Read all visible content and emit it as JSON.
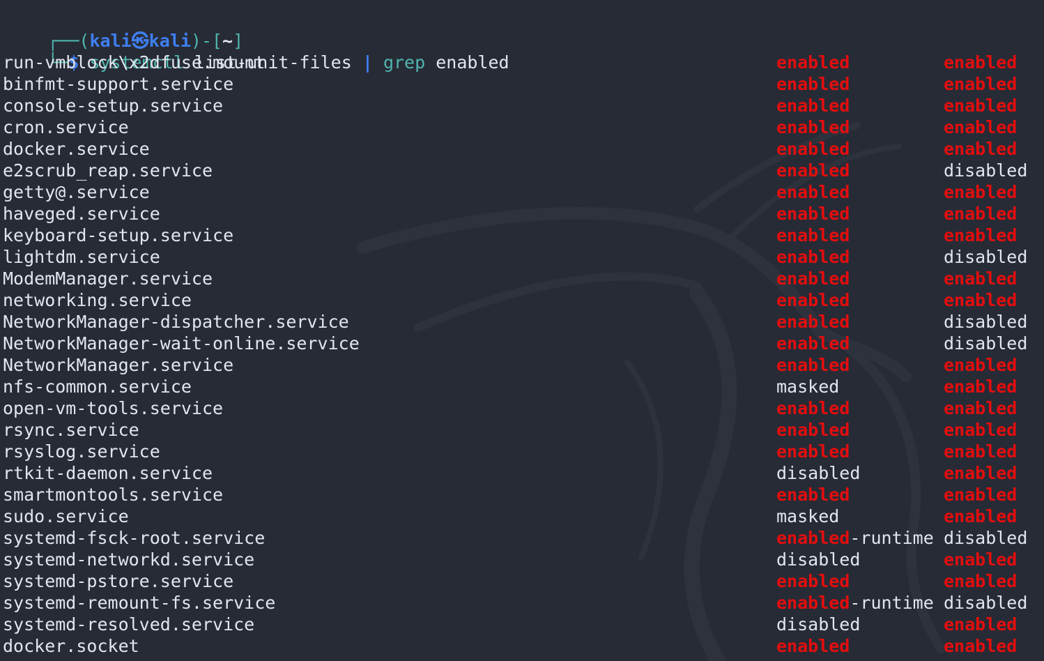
{
  "prompt": {
    "frame_open": "┌──(",
    "user": "kali",
    "at_symbol": "㉿",
    "host": "kali",
    "frame_mid": ")-[",
    "cwd": "~",
    "frame_close": "]",
    "frame_bottom": "└─",
    "dollar": "$",
    "command": "systemctl",
    "args": "list-unit-files",
    "pipe": "|",
    "pipe_command": "grep",
    "pipe_args": "enabled"
  },
  "colors": {
    "background": "#272b36",
    "text": "#e2e6ec",
    "match_highlight": "#e30e0e",
    "prompt_green": "#4fb6ae",
    "prompt_blue": "#3f7ff0"
  },
  "output_rows": [
    {
      "unit": "run-vmblock\\x2dfuse.mount",
      "state": "enabled",
      "state_suffix": "",
      "preset": "enabled"
    },
    {
      "unit": "binfmt-support.service",
      "state": "enabled",
      "state_suffix": "",
      "preset": "enabled"
    },
    {
      "unit": "console-setup.service",
      "state": "enabled",
      "state_suffix": "",
      "preset": "enabled"
    },
    {
      "unit": "cron.service",
      "state": "enabled",
      "state_suffix": "",
      "preset": "enabled"
    },
    {
      "unit": "docker.service",
      "state": "enabled",
      "state_suffix": "",
      "preset": "enabled"
    },
    {
      "unit": "e2scrub_reap.service",
      "state": "enabled",
      "state_suffix": "",
      "preset": "disabled"
    },
    {
      "unit": "getty@.service",
      "state": "enabled",
      "state_suffix": "",
      "preset": "enabled"
    },
    {
      "unit": "haveged.service",
      "state": "enabled",
      "state_suffix": "",
      "preset": "enabled"
    },
    {
      "unit": "keyboard-setup.service",
      "state": "enabled",
      "state_suffix": "",
      "preset": "enabled"
    },
    {
      "unit": "lightdm.service",
      "state": "enabled",
      "state_suffix": "",
      "preset": "disabled"
    },
    {
      "unit": "ModemManager.service",
      "state": "enabled",
      "state_suffix": "",
      "preset": "enabled"
    },
    {
      "unit": "networking.service",
      "state": "enabled",
      "state_suffix": "",
      "preset": "enabled"
    },
    {
      "unit": "NetworkManager-dispatcher.service",
      "state": "enabled",
      "state_suffix": "",
      "preset": "disabled"
    },
    {
      "unit": "NetworkManager-wait-online.service",
      "state": "enabled",
      "state_suffix": "",
      "preset": "disabled"
    },
    {
      "unit": "NetworkManager.service",
      "state": "enabled",
      "state_suffix": "",
      "preset": "enabled"
    },
    {
      "unit": "nfs-common.service",
      "state": "masked",
      "state_suffix": "",
      "preset": "enabled"
    },
    {
      "unit": "open-vm-tools.service",
      "state": "enabled",
      "state_suffix": "",
      "preset": "enabled"
    },
    {
      "unit": "rsync.service",
      "state": "enabled",
      "state_suffix": "",
      "preset": "enabled"
    },
    {
      "unit": "rsyslog.service",
      "state": "enabled",
      "state_suffix": "",
      "preset": "enabled"
    },
    {
      "unit": "rtkit-daemon.service",
      "state": "disabled",
      "state_suffix": "",
      "preset": "enabled"
    },
    {
      "unit": "smartmontools.service",
      "state": "enabled",
      "state_suffix": "",
      "preset": "enabled"
    },
    {
      "unit": "sudo.service",
      "state": "masked",
      "state_suffix": "",
      "preset": "enabled"
    },
    {
      "unit": "systemd-fsck-root.service",
      "state": "enabled",
      "state_suffix": "-runtime",
      "preset": "disabled"
    },
    {
      "unit": "systemd-networkd.service",
      "state": "disabled",
      "state_suffix": "",
      "preset": "enabled"
    },
    {
      "unit": "systemd-pstore.service",
      "state": "enabled",
      "state_suffix": "",
      "preset": "enabled"
    },
    {
      "unit": "systemd-remount-fs.service",
      "state": "enabled",
      "state_suffix": "-runtime",
      "preset": "disabled"
    },
    {
      "unit": "systemd-resolved.service",
      "state": "disabled",
      "state_suffix": "",
      "preset": "enabled"
    },
    {
      "unit": "docker.socket",
      "state": "enabled",
      "state_suffix": "",
      "preset": "enabled"
    }
  ]
}
